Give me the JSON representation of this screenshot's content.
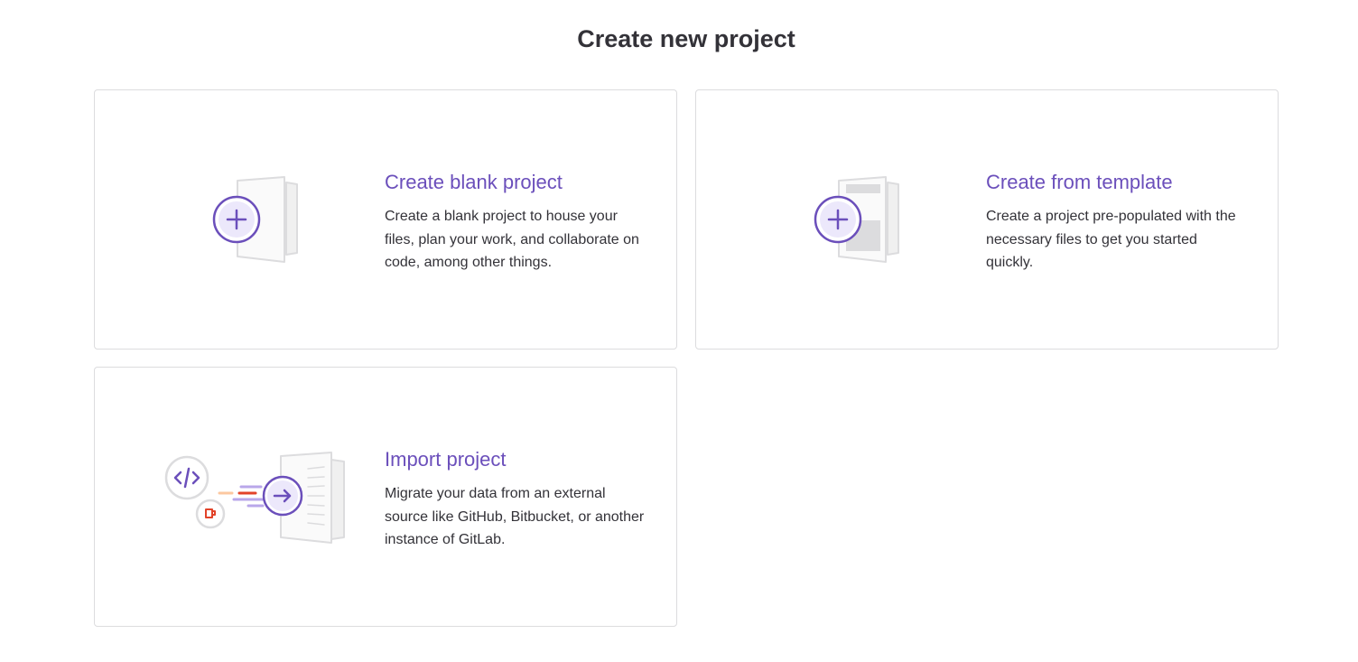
{
  "page": {
    "title": "Create new project"
  },
  "options": [
    {
      "title": "Create blank project",
      "description": "Create a blank project to house your files, plan your work, and collaborate on code, among other things.",
      "icon": "blank-project-illustration"
    },
    {
      "title": "Create from template",
      "description": "Create a project pre-populated with the necessary files to get you started quickly.",
      "icon": "template-project-illustration"
    },
    {
      "title": "Import project",
      "description": "Migrate your data from an external source like GitHub, Bitbucket, or another instance of GitLab.",
      "icon": "import-project-illustration"
    }
  ],
  "colors": {
    "accent": "#6b4fbb",
    "accent_light": "#ece8fb",
    "border": "#dcdcde",
    "paper": "#f0f0f0",
    "paper_stroke": "#dcdcde",
    "orange": "#e24329",
    "orange_light": "#fcc8a0",
    "purple_light": "#b9a7ea"
  }
}
